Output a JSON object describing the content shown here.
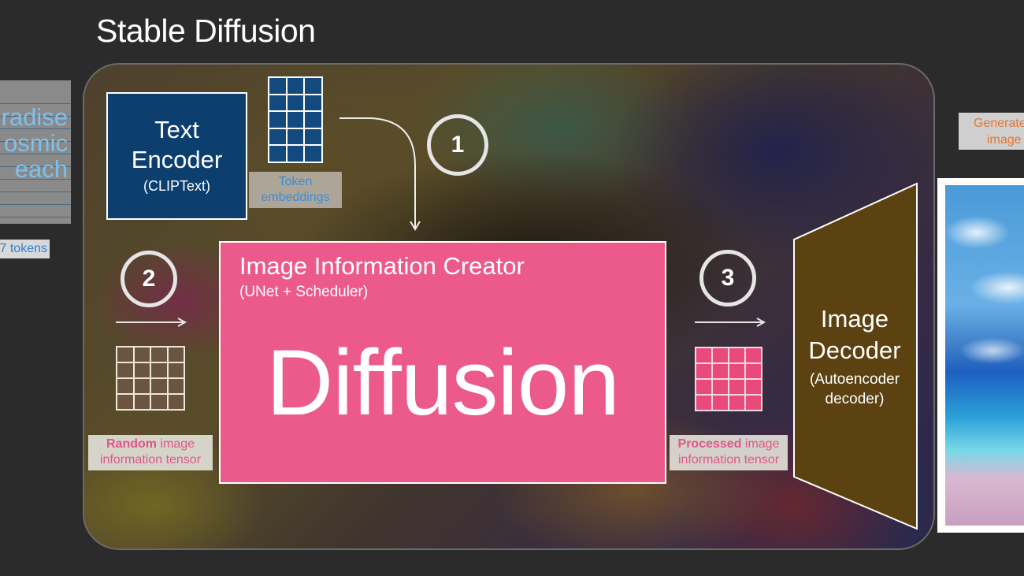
{
  "title": "Stable Diffusion",
  "input_tokens": {
    "words": [
      "radise",
      "osmic",
      "each"
    ],
    "label": "7 tokens"
  },
  "text_encoder": {
    "title": "Text Encoder",
    "subtitle": "(CLIPText)",
    "color": "#0c3f6e"
  },
  "token_embeddings": {
    "caption": "Token embeddings",
    "grid": {
      "rows": 5,
      "cols": 3
    }
  },
  "steps": [
    {
      "number": "1"
    },
    {
      "number": "2"
    },
    {
      "number": "3"
    }
  ],
  "random_tensor": {
    "caption_bold": "Random",
    "caption_rest": " image information tensor",
    "grid": {
      "rows": 4,
      "cols": 4
    }
  },
  "image_information_creator": {
    "title": "Image Information Creator",
    "subtitle": "(UNet + Scheduler)",
    "big_label": "Diffusion",
    "color": "#ec5a8c"
  },
  "processed_tensor": {
    "caption_bold": "Processed",
    "caption_rest": " image information tensor",
    "grid": {
      "rows": 4,
      "cols": 4
    }
  },
  "image_decoder": {
    "title_line1": "Image",
    "title_line2": "Decoder",
    "subtitle_line1": "(Autoencoder",
    "subtitle_line2": "decoder)",
    "color": "#5c4210"
  },
  "generated_image": {
    "label_line1": "Generated",
    "label_line2": "image"
  }
}
